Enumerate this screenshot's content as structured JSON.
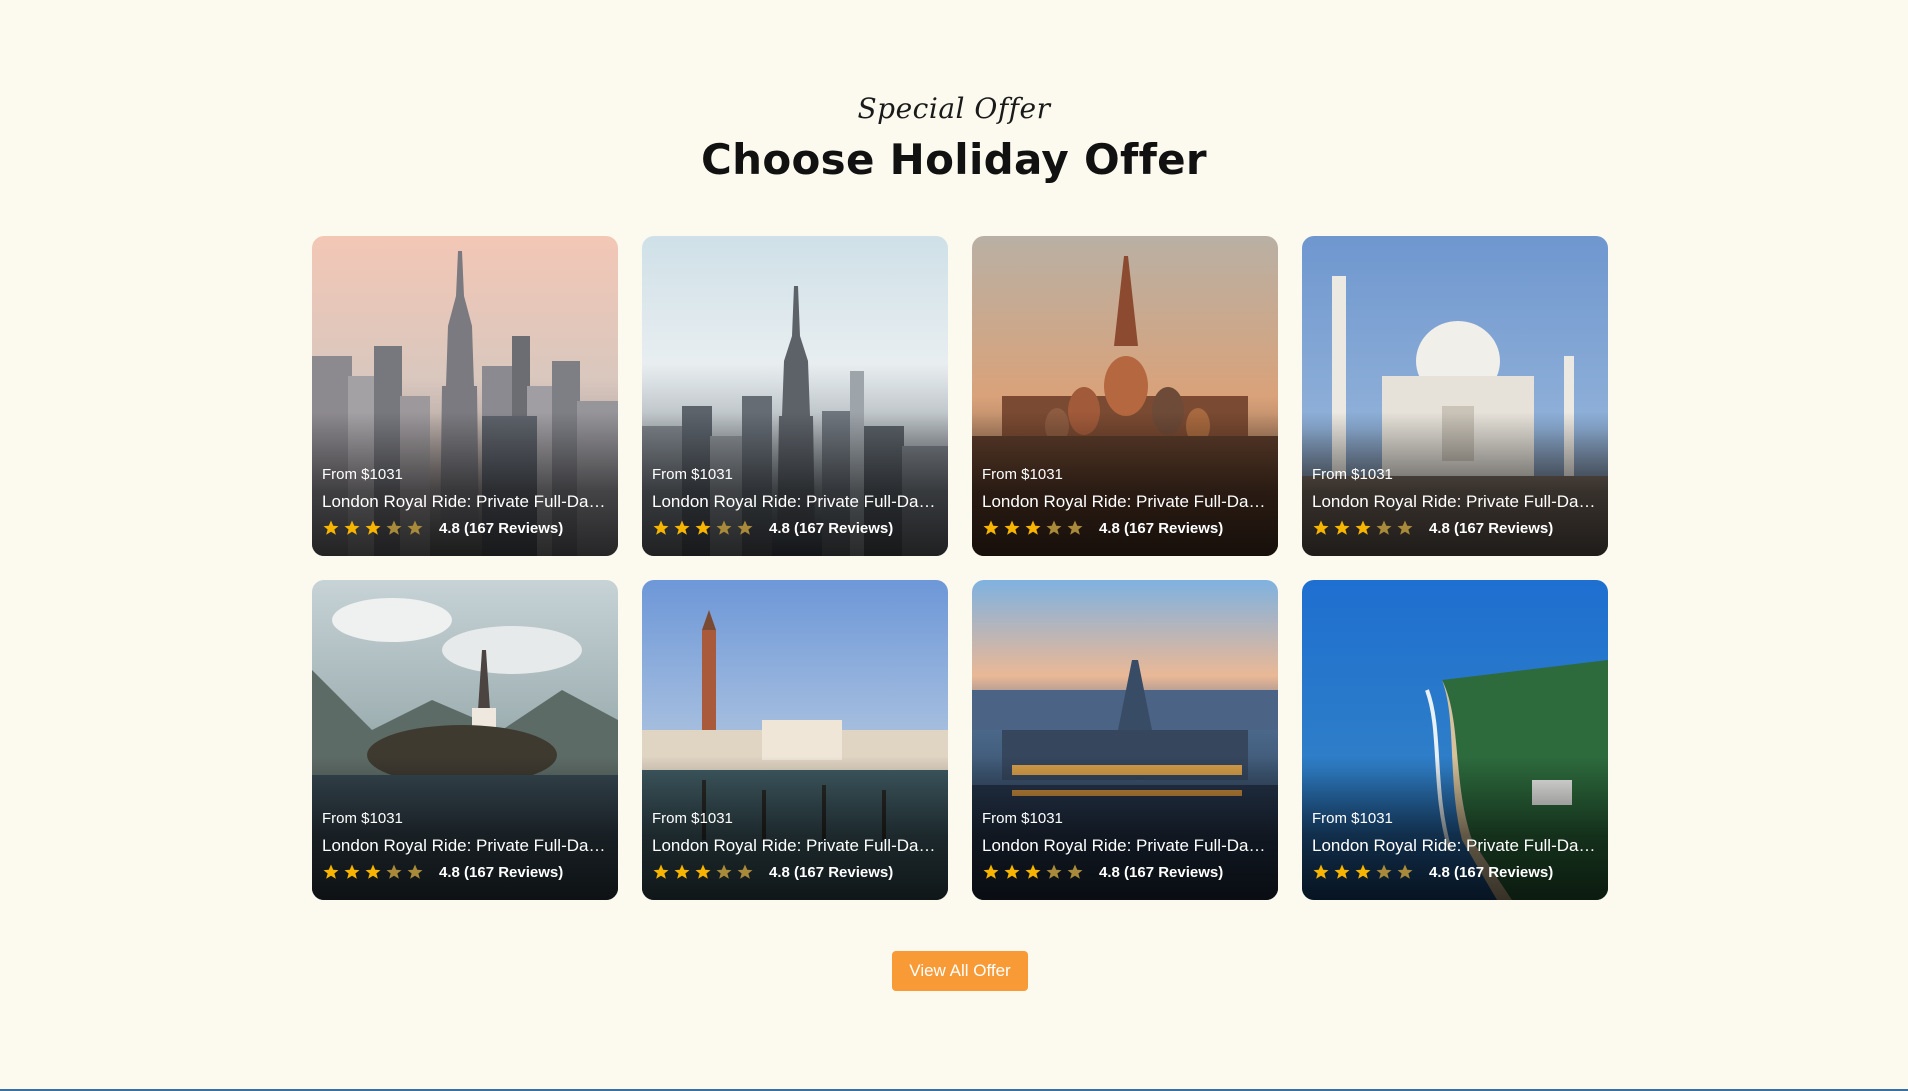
{
  "section": {
    "eyebrow": "Special Offer",
    "title": "Choose Holiday Offer"
  },
  "offers": [
    {
      "scene": "new-york-pink-sky",
      "price": "From $1031",
      "name": "London Royal Ride: Private Full-Day Tour",
      "stars": 3,
      "rating_text": "4.8 (167 Reviews)"
    },
    {
      "scene": "new-york-overcast",
      "price": "From $1031",
      "name": "London Royal Ride: Private Full-Day Tour",
      "stars": 3,
      "rating_text": "4.8 (167 Reviews)"
    },
    {
      "scene": "moscow-st-basil",
      "price": "From $1031",
      "name": "London Royal Ride: Private Full-Day Tour",
      "stars": 3,
      "rating_text": "4.8 (167 Reviews)"
    },
    {
      "scene": "taj-mahal",
      "price": "From $1031",
      "name": "London Royal Ride: Private Full-Day Tour",
      "stars": 3,
      "rating_text": "4.8 (167 Reviews)"
    },
    {
      "scene": "lake-bled",
      "price": "From $1031",
      "name": "London Royal Ride: Private Full-Day Tour",
      "stars": 3,
      "rating_text": "4.8 (167 Reviews)"
    },
    {
      "scene": "venice",
      "price": "From $1031",
      "name": "London Royal Ride: Private Full-Day Tour",
      "stars": 3,
      "rating_text": "4.8 (167 Reviews)"
    },
    {
      "scene": "budapest-parliament",
      "price": "From $1031",
      "name": "London Royal Ride: Private Full-Day Tour",
      "stars": 3,
      "rating_text": "4.8 (167 Reviews)"
    },
    {
      "scene": "coastal-beach",
      "price": "From $1031",
      "name": "London Royal Ride: Private Full-Day Tour",
      "stars": 3,
      "rating_text": "4.8 (167 Reviews)"
    }
  ],
  "cta": {
    "label": "View All Offer"
  },
  "colors": {
    "background": "#fcfaee",
    "accent": "#f89a35",
    "star_filled": "#f7b500",
    "star_empty": "#a88a3a"
  }
}
